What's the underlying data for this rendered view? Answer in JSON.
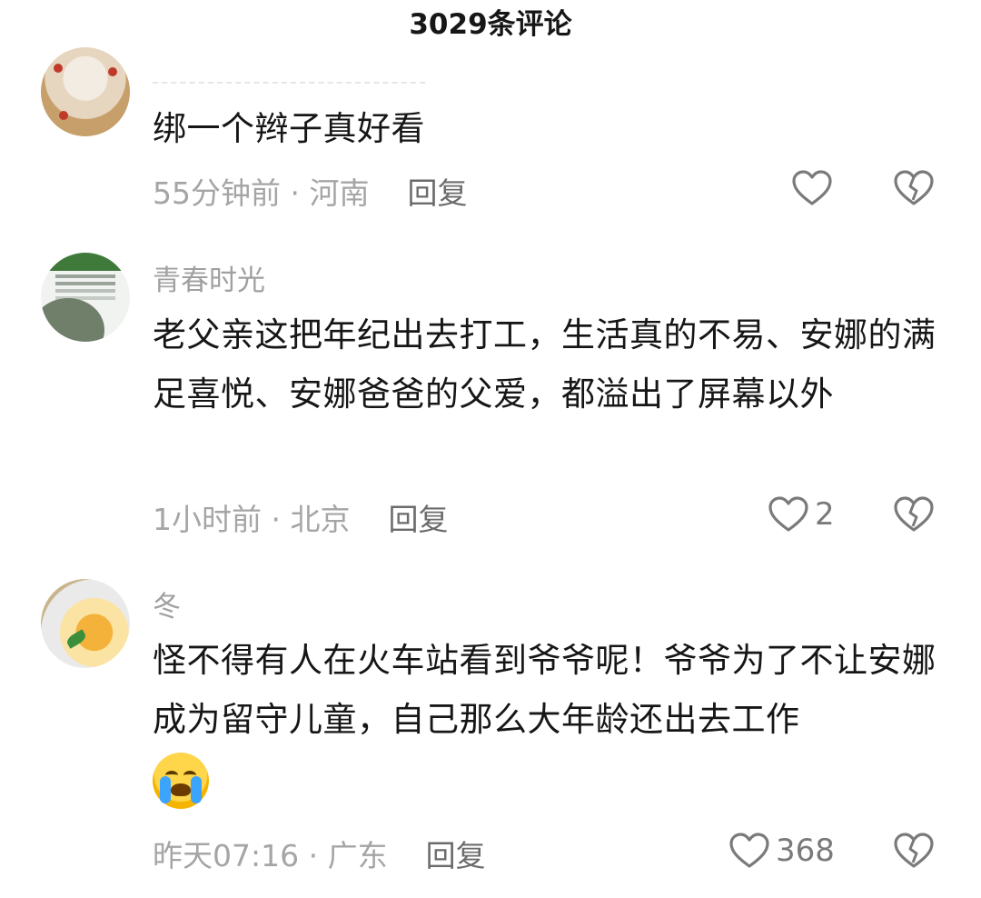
{
  "header": {
    "title": "3029条评论"
  },
  "comments": [
    {
      "username": "",
      "text": "绑一个辫子真好看",
      "time": "55分钟前",
      "location": "河南",
      "reply_label": "回复",
      "likes": ""
    },
    {
      "username": "青春时光",
      "text": "老父亲这把年纪出去打工，生活真的不易、安娜的满足喜悦、安娜爸爸的父爱，都溢出了屏幕以外",
      "time": "1小时前",
      "location": "北京",
      "reply_label": "回复",
      "likes": "2"
    },
    {
      "username": "冬",
      "text": "怪不得有人在火车站看到爷爷呢！爷爷为了不让安娜成为留守儿童，自己那么大年龄还出去工作",
      "time": "昨天07:16",
      "location": "广东",
      "reply_label": "回复",
      "likes": "368"
    }
  ],
  "separator": " · ",
  "icons": {
    "like": "heart-outline-icon",
    "dislike": "broken-heart-icon",
    "emoji": "crying-face-emoji"
  }
}
